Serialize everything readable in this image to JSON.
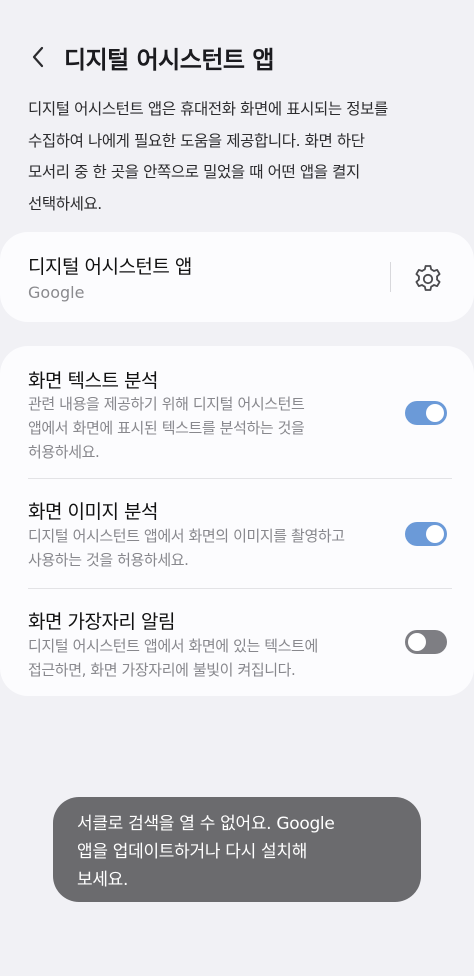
{
  "header": {
    "title": "디지털 어시스턴트 앱"
  },
  "description": {
    "lines": [
      "디지털 어시스턴트 앱은 휴대전화 화면에 표시되는 정보를",
      "수집하여 나에게 필요한 도움을 제공합니다. 화면 하단",
      "모서리 중 한 곳을 안쪽으로 밀었을 때 어떤 앱을 켤지",
      "선택하세요."
    ]
  },
  "app_card": {
    "title": "디지털 어시스턴트 앱",
    "value": "Google"
  },
  "settings": [
    {
      "title": "화면 텍스트 분석",
      "lines": [
        "관련 내용을 제공하기 위해 디지털 어시스턴트",
        "앱에서 화면에 표시된 텍스트를 분석하는 것을",
        "허용하세요."
      ],
      "enabled": true
    },
    {
      "title": "화면 이미지 분석",
      "lines": [
        "디지털 어시스턴트 앱에서 화면의 이미지를 촬영하고",
        "사용하는 것을 허용하세요."
      ],
      "enabled": true
    },
    {
      "title": "화면 가장자리 알림",
      "lines": [
        "디지털 어시스턴트 앱에서 화면에 있는 텍스트에",
        "접근하면, 화면 가장자리에 불빛이 켜집니다."
      ],
      "enabled": false
    }
  ],
  "toast": {
    "lines": [
      "서클로 검색을 열 수 없어요. Google",
      "앱을 업데이트하거나 다시 설치해",
      "보세요."
    ]
  },
  "colors": {
    "toggle_on": "#6b9ad8",
    "toggle_off": "#7e7e83",
    "background": "#f1f1f5",
    "card": "#fcfcfe"
  }
}
